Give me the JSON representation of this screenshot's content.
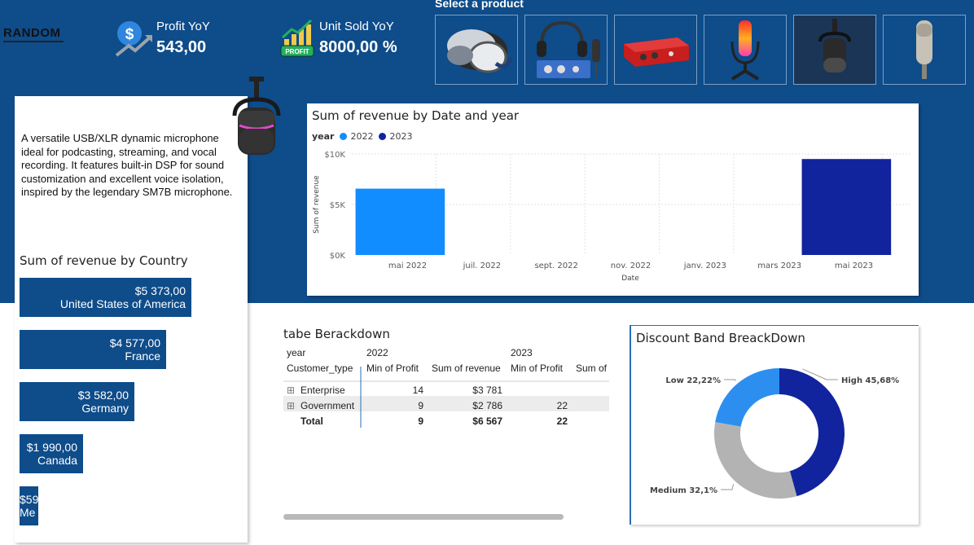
{
  "logo": {
    "text": "RANDOM"
  },
  "kpis": {
    "profit": {
      "label": "Profit YoY",
      "value": "543,00",
      "icon": "dollar-growth-icon"
    },
    "units": {
      "label": "Unit Sold YoY",
      "value": "8000,00 %",
      "icon": "profit-chart-icon",
      "badge": "PROFIT"
    }
  },
  "slicer": {
    "title": "Select a product",
    "items": [
      {
        "name": "headphones",
        "selected": false
      },
      {
        "name": "audio-interface-bundle",
        "selected": false
      },
      {
        "name": "red-audio-interface",
        "selected": false
      },
      {
        "name": "rgb-microphone",
        "selected": false
      },
      {
        "name": "dynamic-microphone",
        "selected": true
      },
      {
        "name": "condenser-microphone",
        "selected": false
      }
    ]
  },
  "product": {
    "description": "A versatile USB/XLR dynamic microphone ideal for podcasting, streaming, and vocal recording. It features built-in DSP for sound customization and excellent voice isolation, inspired by the legendary SM7B microphone."
  },
  "country_chart": {
    "title": "Sum of revenue by Country",
    "bars": [
      {
        "value": "$5 373,00",
        "country": "United States of America",
        "amount": 5373
      },
      {
        "value": "$4 577,00",
        "country": "France",
        "amount": 4577
      },
      {
        "value": "$3 582,00",
        "country": "Germany",
        "amount": 3582
      },
      {
        "value": "$1 990,00",
        "country": "Canada",
        "amount": 1990
      },
      {
        "value": "$59",
        "country": "Me",
        "amount": 590
      }
    ]
  },
  "date_chart": {
    "title": "Sum of revenue by Date and year",
    "legend_label": "year",
    "xlabel": "Date",
    "ylabel": "Sum of revenue",
    "yticks": [
      "$10K",
      "$5K",
      "$0K"
    ],
    "xticks": [
      "mai 2022",
      "juil. 2022",
      "sept. 2022",
      "nov. 2022",
      "janv. 2023",
      "mars 2023",
      "mai 2023"
    ]
  },
  "chart_data": {
    "type": "bar",
    "title": "Sum of revenue by Date and year",
    "xlabel": "Date",
    "ylabel": "Sum of revenue",
    "ylim": [
      0,
      10000
    ],
    "series": [
      {
        "name": "2022",
        "color": "#118dff",
        "points": [
          {
            "x_start": "2022-04",
            "x_end": "2022-06",
            "value": 6567
          }
        ]
      },
      {
        "name": "2023",
        "color": "#12239e",
        "points": [
          {
            "x_start": "2023-04",
            "x_end": "2023-06",
            "value": 9500
          }
        ]
      }
    ],
    "legend": "top-left",
    "grid": true
  },
  "table": {
    "title": "tabe Berackdown",
    "header_row1": {
      "col0": "year",
      "year1": "2022",
      "year2": "2023"
    },
    "header_row2": {
      "col0": "Customer_type",
      "c1": "Min of Profit",
      "c2": "Sum of revenue",
      "c3": "Min of Profit",
      "c4": "Sum of"
    },
    "rows": [
      {
        "type": "Enterprise",
        "min1": "14",
        "sum1": "$3 781",
        "min2": "",
        "sum2": ""
      },
      {
        "type": "Government",
        "min1": "9",
        "sum1": "$2 786",
        "min2": "22",
        "sum2": ""
      }
    ],
    "total": {
      "label": "Total",
      "min1": "9",
      "sum1": "$6 567",
      "min2": "22",
      "sum2": ""
    }
  },
  "donut": {
    "title": "Discount Band BreackDown",
    "slices": [
      {
        "label": "High 45,68%",
        "value": 45.68,
        "color": "#12239e"
      },
      {
        "label": "Medium 32,1%",
        "value": 32.1,
        "color": "#b3b3b3"
      },
      {
        "label": "Low 22,22%",
        "value": 22.22,
        "color": "#2c8ff0"
      }
    ]
  }
}
